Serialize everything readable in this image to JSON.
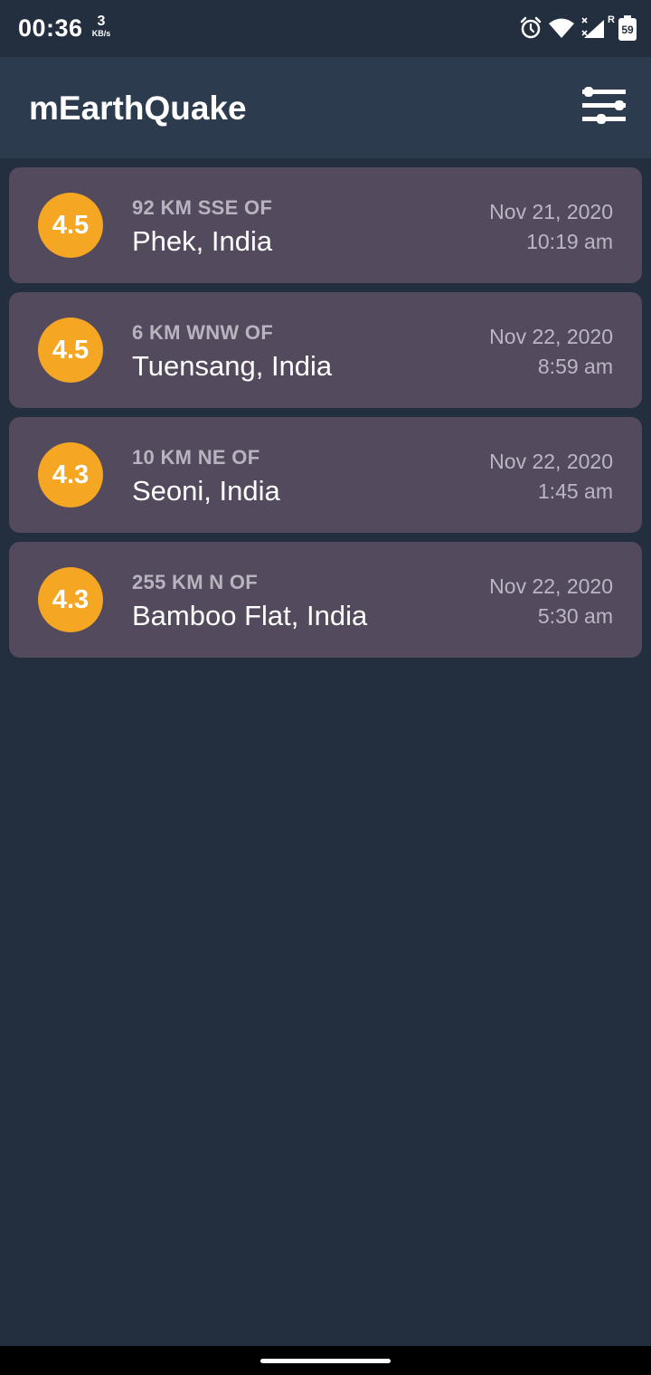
{
  "status_bar": {
    "time": "00:36",
    "net_speed_value": "3",
    "net_speed_unit": "KB/s",
    "signal_label": "R",
    "battery_level": "59",
    "icons": [
      "alarm-icon",
      "wifi-icon",
      "signal-icon",
      "battery-icon"
    ]
  },
  "app_bar": {
    "title": "mEarthQuake",
    "filter_icon": "sliders-icon"
  },
  "colors": {
    "background": "#232f3e",
    "app_bar": "#2c3c4e",
    "card": "#544a5e",
    "magnitude": "#f5a623"
  },
  "quakes": [
    {
      "magnitude": "4.5",
      "offset": "92 KM SSE OF",
      "location": "Phek, India",
      "date": "Nov 21, 2020",
      "time": "10:19 am"
    },
    {
      "magnitude": "4.5",
      "offset": "6 KM WNW OF",
      "location": "Tuensang, India",
      "date": "Nov 22, 2020",
      "time": "8:59 am"
    },
    {
      "magnitude": "4.3",
      "offset": "10 KM NE OF",
      "location": "Seoni, India",
      "date": "Nov 22, 2020",
      "time": "1:45 am"
    },
    {
      "magnitude": "4.3",
      "offset": "255 KM N OF",
      "location": "Bamboo Flat, India",
      "date": "Nov 22, 2020",
      "time": "5:30 am"
    }
  ]
}
